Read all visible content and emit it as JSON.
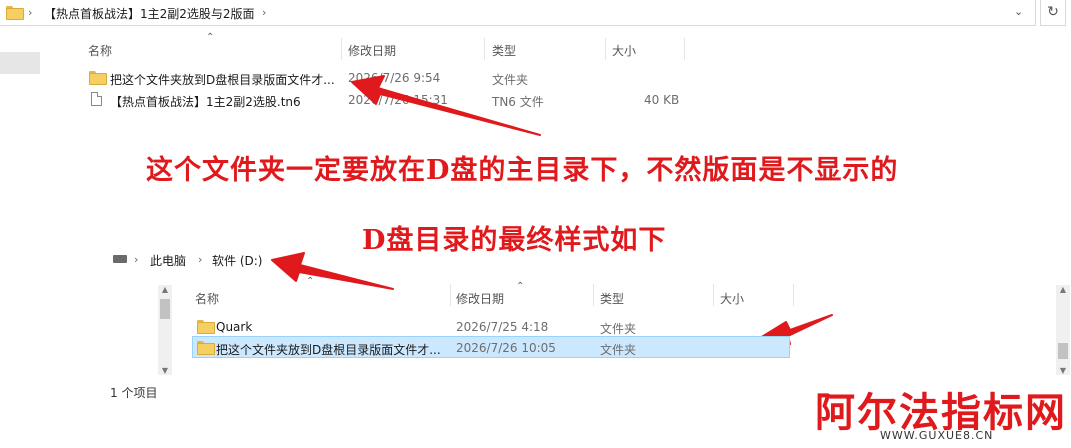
{
  "top_window": {
    "breadcrumb": "【热点首板战法】1主2副2选股与2版面",
    "columns": {
      "name": "名称",
      "modified": "修改日期",
      "type": "类型",
      "size": "大小"
    },
    "rows": [
      {
        "name": "把这个文件夹放到D盘根目录版面文件才...",
        "modified": "2026/7/26 9:54",
        "type": "文件夹",
        "size": ""
      },
      {
        "name": "【热点首板战法】1主2副2选股.tn6",
        "modified": "2026/7/26 15:31",
        "type": "TN6 文件",
        "size": "40 KB"
      }
    ]
  },
  "annotations": {
    "line1": "这个文件夹一定要放在D盘的主目录下，不然版面是不显示的",
    "line2": "D盘目录的最终样式如下"
  },
  "bottom_window": {
    "breadcrumb": [
      "此电脑",
      "软件 (D:)"
    ],
    "columns": {
      "name": "名称",
      "modified": "修改日期",
      "type": "类型",
      "size": "大小"
    },
    "rows": [
      {
        "name": "Quark",
        "modified": "2026/7/25 4:18",
        "type": "文件夹"
      },
      {
        "name": "把这个文件夹放到D盘根目录版面文件才...",
        "modified": "2026/7/26 10:05",
        "type": "文件夹"
      }
    ],
    "status": "1 个项目"
  },
  "watermark": {
    "title": "阿尔法指标网",
    "url": "WWW.GUXUE8.CN"
  },
  "colors": {
    "accent_red": "#e0191c",
    "selection": "#cce8ff"
  }
}
